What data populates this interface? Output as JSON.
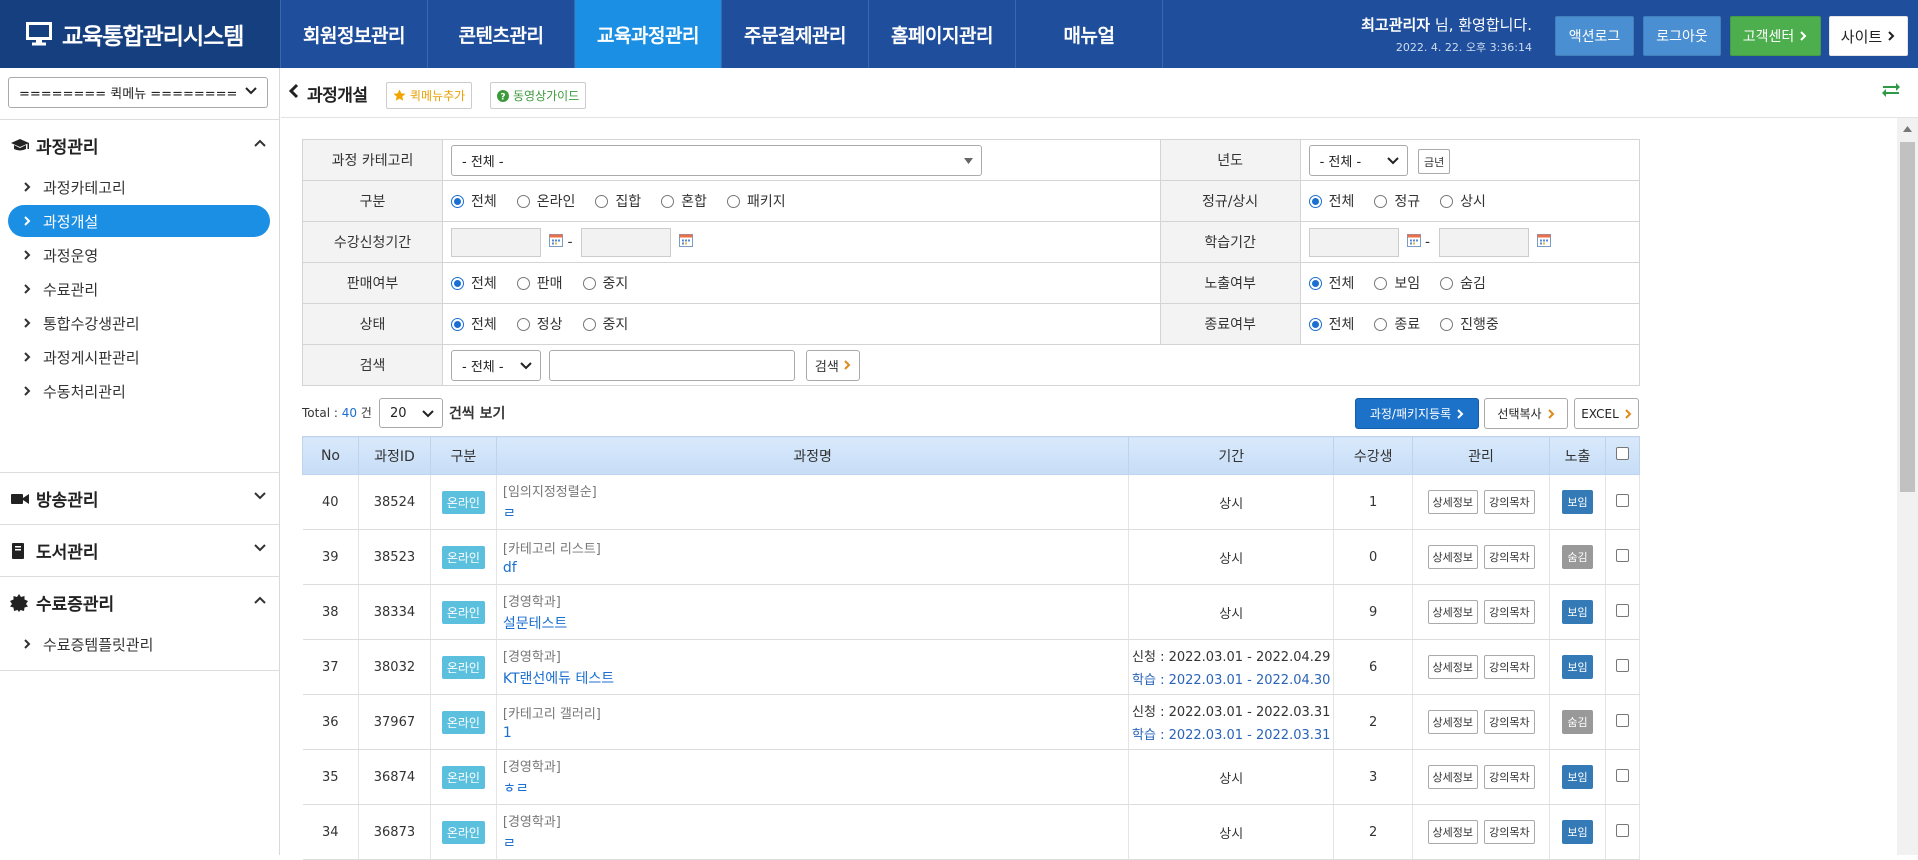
{
  "header": {
    "logo": "교육통합관리시스템",
    "menu": [
      "회원정보관리",
      "콘텐츠관리",
      "교육과정관리",
      "주문결제관리",
      "홈페이지관리",
      "매뉴얼"
    ],
    "welcome_name": "최고관리자",
    "welcome_suffix": " 님, 환영합니다.",
    "datetime": "2022. 4. 22. 오후 3:36:14",
    "btn_log": "액션로그",
    "btn_logout": "로그아웃",
    "btn_cs": "고객센터",
    "btn_site": "사이트"
  },
  "sidebar": {
    "quick_menu": "======== 퀵메뉴 ========",
    "sections": [
      {
        "title": "과정관리",
        "items": [
          "과정카테고리",
          "과정개설",
          "과정운영",
          "수료관리",
          "통합수강생관리",
          "과정게시판관리",
          "수동처리관리"
        ]
      },
      {
        "title": "방송관리",
        "items": []
      },
      {
        "title": "도서관리",
        "items": []
      },
      {
        "title": "수료증관리",
        "items": [
          "수료증템플릿관리"
        ]
      }
    ]
  },
  "topbar": {
    "title": "과정개설",
    "quick_add": "퀵메뉴추가",
    "video_guide": "동영상가이드"
  },
  "search": {
    "category_label": "과정 카테고리",
    "category_value": "- 전체 -",
    "year_label": "년도",
    "year_value": "- 전체 -",
    "year_btn": "금년",
    "type_label": "구분",
    "type_options": [
      "전체",
      "온라인",
      "집합",
      "혼합",
      "패키지"
    ],
    "regular_label": "정규/상시",
    "regular_options": [
      "전체",
      "정규",
      "상시"
    ],
    "apply_label": "수강신청기간",
    "study_label": "학습기간",
    "sale_label": "판매여부",
    "sale_options": [
      "전체",
      "판매",
      "중지"
    ],
    "display_label": "노출여부",
    "display_options": [
      "전체",
      "보임",
      "숨김"
    ],
    "status_label": "상태",
    "status_options": [
      "전체",
      "정상",
      "중지"
    ],
    "end_label": "종료여부",
    "end_options": [
      "전체",
      "종료",
      "진행중"
    ],
    "keyword_label": "검색",
    "keyword_field": "- 전체 -",
    "search_btn": "검색"
  },
  "list": {
    "total_prefix": "Total : ",
    "total_count": "40",
    "total_suffix": " 건",
    "per_page": "20",
    "per_page_label": "건씩 보기",
    "btn_register": "과정/패키지등록",
    "btn_copy": "선택복사",
    "btn_excel": "EXCEL",
    "columns": [
      "No",
      "과정ID",
      "구분",
      "과정명",
      "기간",
      "수강생",
      "관리",
      "노출"
    ],
    "detail_btn": "상세정보",
    "lecture_btn": "강의목차",
    "rows": [
      {
        "no": "40",
        "id": "38524",
        "type": "온라인",
        "category": "[임의지정정렬순]",
        "title": "ㄹ",
        "period_apply": "상시",
        "period_study": "",
        "students": "1",
        "visible": "보임"
      },
      {
        "no": "39",
        "id": "38523",
        "type": "온라인",
        "category": "[카테고리 리스트]",
        "title": "df",
        "period_apply": "상시",
        "period_study": "",
        "students": "0",
        "visible": "숨김"
      },
      {
        "no": "38",
        "id": "38334",
        "type": "온라인",
        "category": "[경영학과]",
        "title": "설문테스트",
        "period_apply": "상시",
        "period_study": "",
        "students": "9",
        "visible": "보임"
      },
      {
        "no": "37",
        "id": "38032",
        "type": "온라인",
        "category": "[경영학과]",
        "title": "KT랜선에듀 테스트",
        "period_apply": "신청 : 2022.03.01 - 2022.04.29",
        "period_study": "학습 : 2022.03.01 - 2022.04.30",
        "students": "6",
        "visible": "보임"
      },
      {
        "no": "36",
        "id": "37967",
        "type": "온라인",
        "category": "[카테고리 갤러리]",
        "title": "1",
        "period_apply": "신청 : 2022.03.01 - 2022.03.31",
        "period_study": "학습 : 2022.03.01 - 2022.03.31",
        "students": "2",
        "visible": "숨김"
      },
      {
        "no": "35",
        "id": "36874",
        "type": "온라인",
        "category": "[경영학과]",
        "title": "ㅎㄹ",
        "period_apply": "상시",
        "period_study": "",
        "students": "3",
        "visible": "보임"
      },
      {
        "no": "34",
        "id": "36873",
        "type": "온라인",
        "category": "[경영학과]",
        "title": "ㄹ",
        "period_apply": "상시",
        "period_study": "",
        "students": "2",
        "visible": "보임"
      }
    ]
  }
}
